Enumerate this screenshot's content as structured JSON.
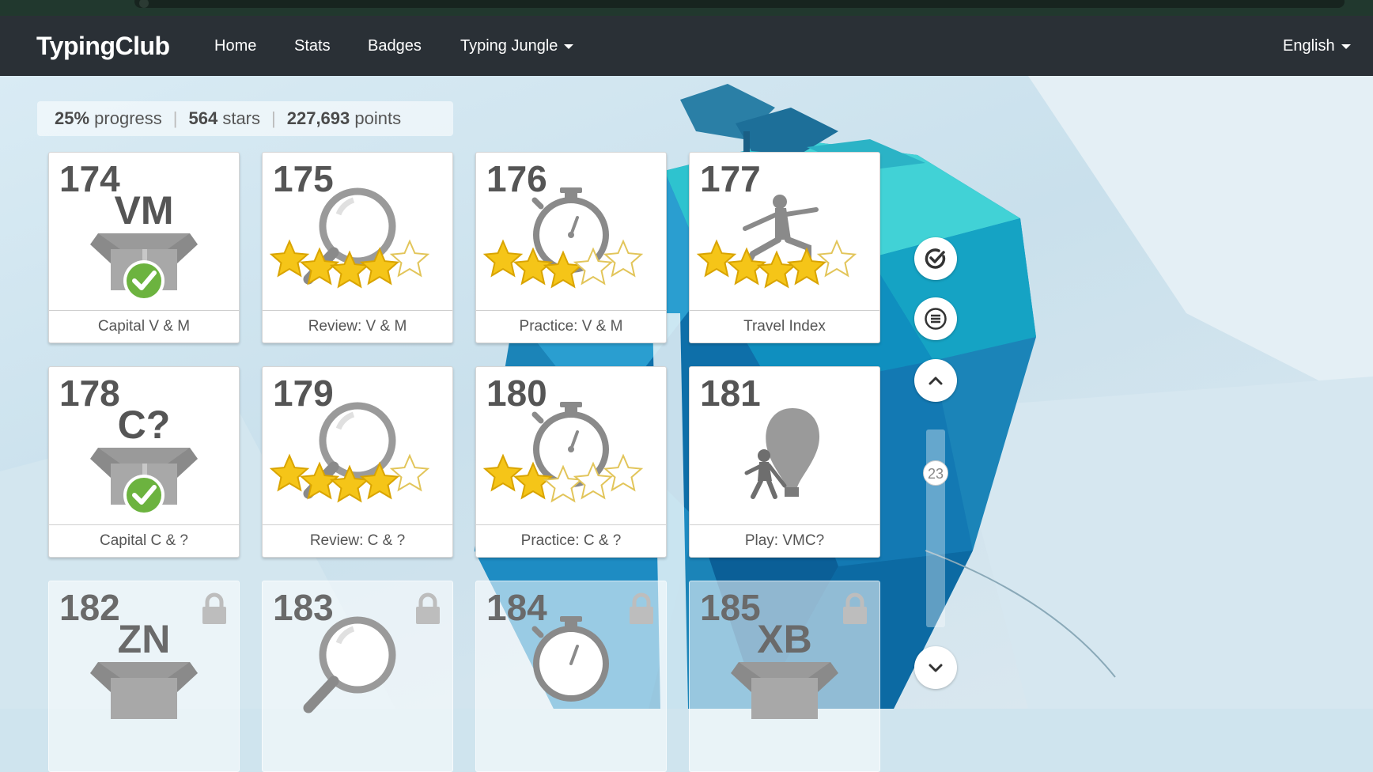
{
  "navbar": {
    "brand": "TypingClub",
    "items": [
      "Home",
      "Stats",
      "Badges",
      "Typing Jungle"
    ],
    "language": "English"
  },
  "summary": {
    "progress": "25%",
    "progress_label": "progress",
    "stars": "564",
    "stars_label": "stars",
    "points": "227,693",
    "points_label": "points"
  },
  "lessons": [
    {
      "num": "174",
      "title": "Capital V & M",
      "type": "new-keys",
      "keys": "VM",
      "completed": true
    },
    {
      "num": "175",
      "title": "Review: V & M",
      "type": "review",
      "stars": 4
    },
    {
      "num": "176",
      "title": "Practice: V & M",
      "type": "practice",
      "stars": 3
    },
    {
      "num": "177",
      "title": "Travel Index",
      "type": "game",
      "stars": 4
    },
    {
      "num": "178",
      "title": "Capital C & ?",
      "type": "new-keys",
      "keys": "C?",
      "completed": true
    },
    {
      "num": "179",
      "title": "Review: C & ?",
      "type": "review",
      "stars": 4
    },
    {
      "num": "180",
      "title": "Practice: C & ?",
      "type": "practice",
      "stars": 2
    },
    {
      "num": "181",
      "title": "Play: VMC?",
      "type": "game",
      "stars": 0
    },
    {
      "num": "182",
      "type": "new-keys",
      "keys": "ZN",
      "locked": true
    },
    {
      "num": "183",
      "type": "review",
      "locked": true
    },
    {
      "num": "184",
      "type": "practice",
      "locked": true
    },
    {
      "num": "185",
      "type": "new-keys",
      "keys": "XB",
      "locked": true
    }
  ],
  "sidebar": {
    "page_indicator": "23",
    "icons": [
      "check-circle-icon",
      "menu-icon",
      "chevron-up-icon",
      "chevron-down-icon"
    ]
  },
  "colors": {
    "navbar": "#2a3036",
    "star": "#f5c518",
    "check": "#6cb33f"
  }
}
